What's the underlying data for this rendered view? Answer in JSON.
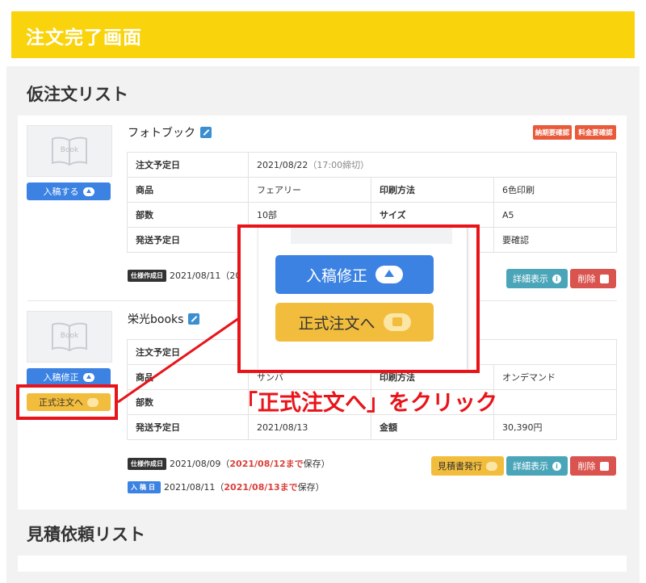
{
  "header": {
    "title": "注文完了画面"
  },
  "provisional": {
    "title": "仮注文リスト",
    "thumb_label": "Book",
    "items": [
      {
        "name": "フォトブック",
        "upload_button": "入稿する",
        "badges": [
          "納期要確認",
          "料金要確認"
        ],
        "rows": [
          {
            "k1": "注文予定日",
            "v1": "2021/08/22",
            "v1_note": "（17:00締切）"
          },
          {
            "k1": "商品",
            "v1": "フェアリー",
            "k2": "印刷方法",
            "v2": "6色印刷"
          },
          {
            "k1": "部数",
            "v1": "10部",
            "k2": "サイズ",
            "v2": "A5"
          },
          {
            "k1": "発送予定日",
            "v1": "",
            "k2": "",
            "v2": "要確認"
          }
        ],
        "spec_tag": "仕様作成日",
        "spec_date": "2021/08/11（20",
        "detail_button": "詳細表示",
        "delete_button": "削除"
      },
      {
        "name": "栄光books",
        "upload_button": "入稿修正",
        "order_button": "正式注文へ",
        "rows": [
          {
            "k1": "注文予定日",
            "v1": ""
          },
          {
            "k1": "商品",
            "v1": "サンバ",
            "k2": "印刷方法",
            "v2": "オンデマンド"
          },
          {
            "k1": "部数",
            "v1": "",
            "k2": "",
            "v2": ""
          },
          {
            "k1": "発送予定日",
            "v1": "2021/08/13",
            "k2": "金額",
            "v2": "30,390円"
          }
        ],
        "spec_tag": "仕様作成日",
        "spec_date": "2021/08/09（",
        "spec_until": "2021/08/12まで",
        "spec_suffix": "保存）",
        "upload_tag": "入稿日",
        "upload_date": "2021/08/11（",
        "upload_until": "2021/08/13まで",
        "upload_suffix": "保存）",
        "estimate_button": "見積書発行",
        "detail_button": "詳細表示",
        "delete_button": "削除"
      }
    ]
  },
  "zoom": {
    "upload_button": "入稿修正",
    "order_button": "正式注文へ"
  },
  "callout": {
    "text": "「正式注文へ」をクリック"
  },
  "estimate_list": {
    "title": "見積依頼リスト"
  },
  "colors": {
    "header": "#f9d30b",
    "blue": "#3b82e3",
    "yellow": "#f2bd3d",
    "teal": "#4ba5b9",
    "red": "#d9534f",
    "highlight": "#e8141a"
  }
}
